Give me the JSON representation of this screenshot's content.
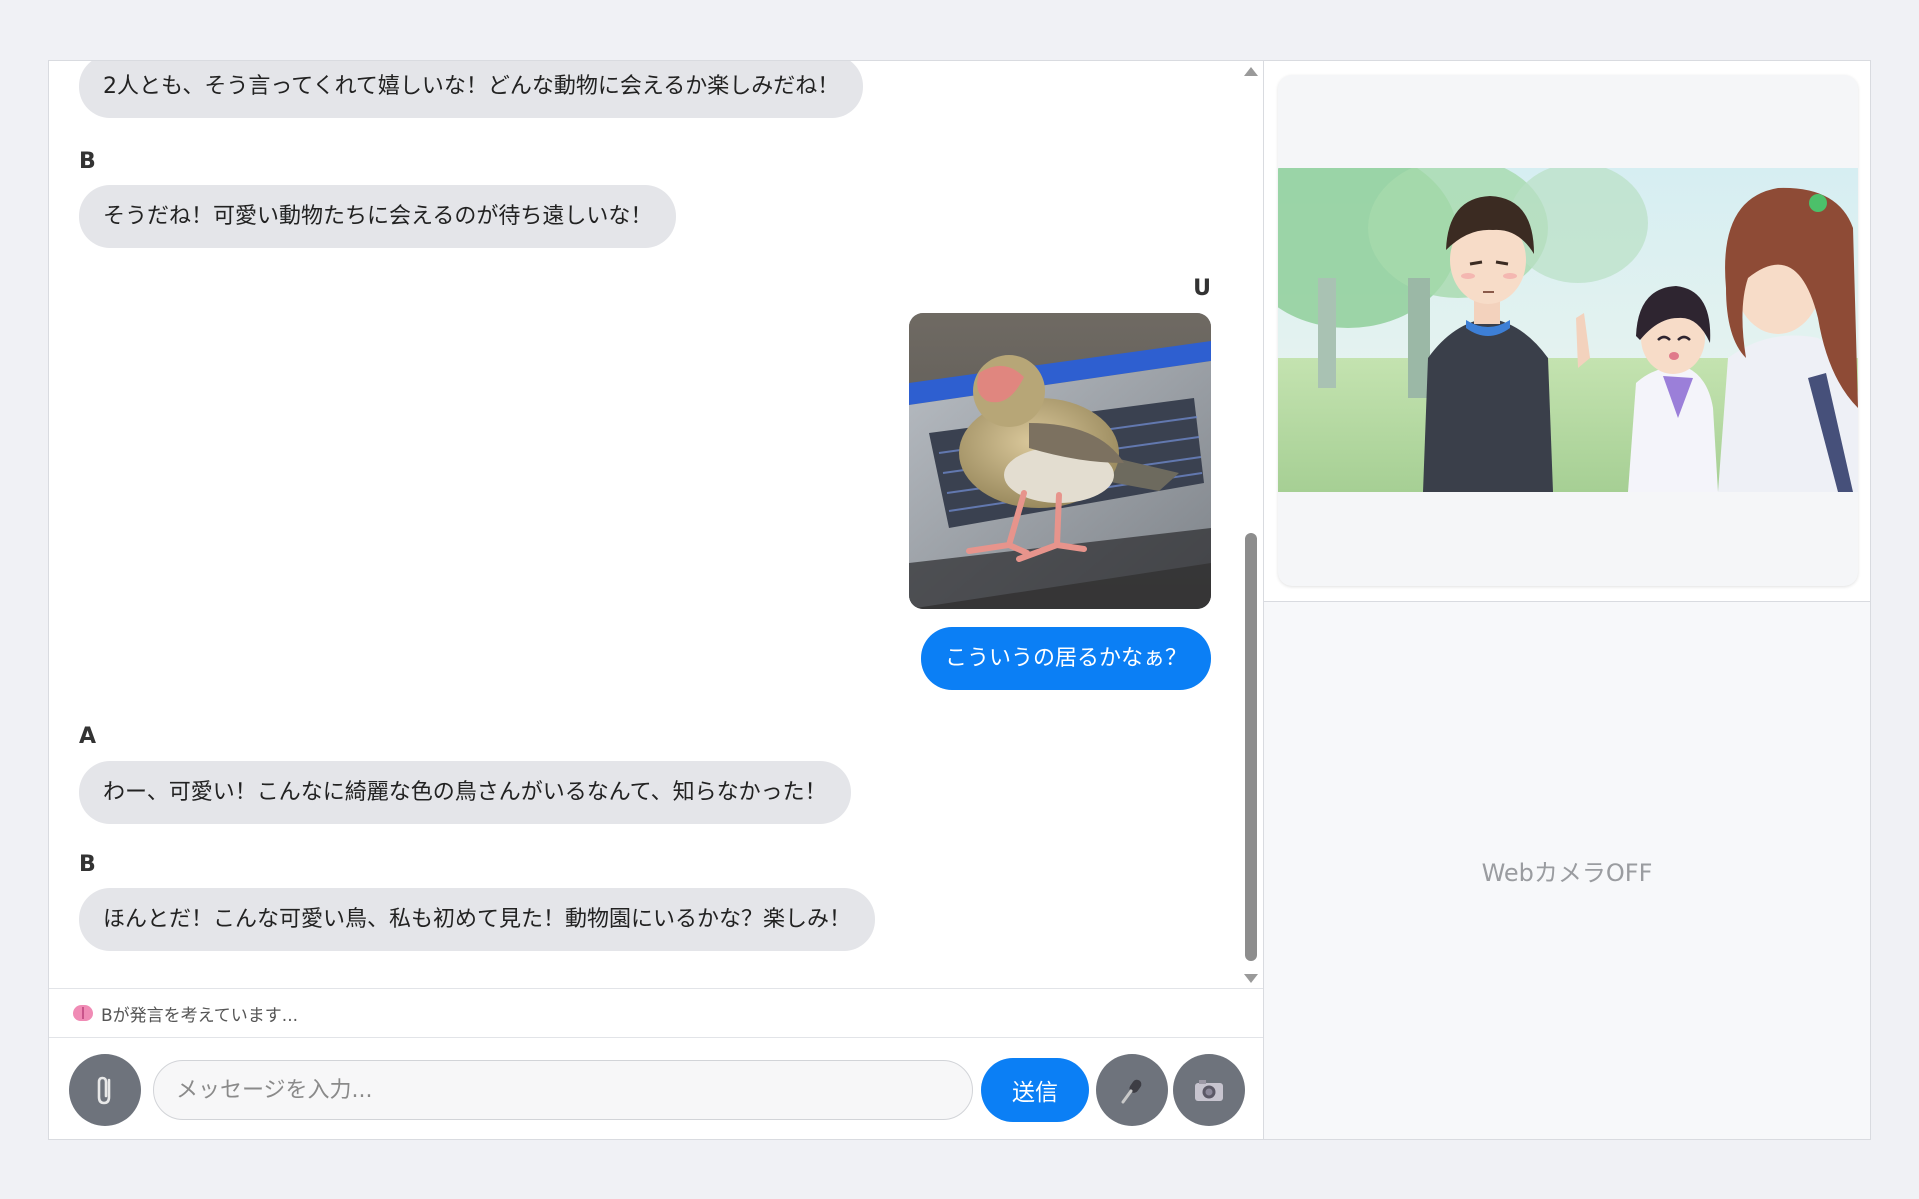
{
  "chat": {
    "messages": [
      {
        "sender": "",
        "text": "2人とも、そう言ってくれて嬉しいな！どんな動物に会えるか楽しみだね！"
      },
      {
        "sender": "B",
        "text": "そうだね！可愛い動物たちに会えるのが待ち遠しいな！"
      },
      {
        "sender": "U",
        "text": "こういうの居るかなぁ？"
      },
      {
        "sender": "A",
        "text": "わー、可愛い！こんなに綺麗な色の鳥さんがいるなんて、知らなかった！"
      },
      {
        "sender": "B",
        "text": "ほんとだ！こんな可愛い鳥、私も初めて見た！動物園にいるかな？楽しみ！"
      }
    ],
    "status_text": "Bが発言を考えています..."
  },
  "composer": {
    "placeholder": "メッセージを入力...",
    "send_label": "送信",
    "attach_icon": "paperclip-icon",
    "mic_icon": "microphone-icon",
    "camera_icon": "camera-icon"
  },
  "side": {
    "webcam_text": "WebカメラOFF"
  },
  "colors": {
    "accent": "#0b7ff5",
    "bubble_bg": "#e4e5e9",
    "button_gray": "#6e737c"
  }
}
